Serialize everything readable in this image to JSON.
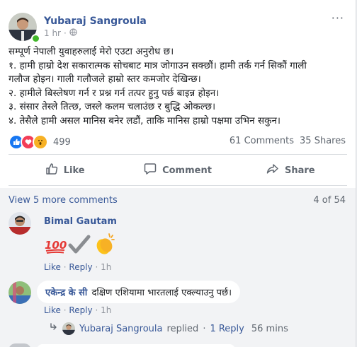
{
  "post": {
    "author": "Yubaraj Sangroula",
    "time": "1 hr",
    "time_sep": "·",
    "body_lines": [
      "सम्पूर्ण नेपाली युवाहरुलाई मेरो एउटा अनुरोध छ।",
      "१. हामी हाम्रो देश सकारात्मक सोचबाट मात्र जोगाउन सक्छौं। हामी तर्क गर्न सिकौं गाली",
      "गलौज होइन। गाली गलौजले हाम्रो स्तर कमजोर देखिन्छ।",
      "२. हामीले बिस्लेषण गर्न र प्रश्न गर्न तत्पर हुनु पर्छ बाइन्न होइन।",
      "३. संसार तेस्ले तित्छ, जस्ले कलम चलाउंछ र बुद्धि ओकल्छ।",
      "४. तेसैले हामी असल मानिस बनेर लडौं, ताकि मानिस हाम्रो पक्षमा उभिन सकुन।"
    ],
    "reaction_count": "499",
    "comments_count": "61 Comments",
    "shares_count": "35 Shares"
  },
  "actions": {
    "like": "Like",
    "comment": "Comment",
    "share": "Share"
  },
  "comments_header": {
    "view_more": "View 5 more comments",
    "page": "4 of 54"
  },
  "comments": [
    {
      "author": "Bimal Gautam",
      "emojis": [
        "100",
        "heavy-check",
        "clapping-hands"
      ],
      "emoji_text": "💯✔👏",
      "like": "Like",
      "reply": "Reply",
      "time": "1h",
      "sep": "·"
    },
    {
      "author": "एकेन्द्र के सी",
      "text": "दक्षिण एशियामा भारतलाई एक्ल्याउनु पर्छ।",
      "like": "Like",
      "reply": "Reply",
      "time": "1h",
      "sep": "·"
    }
  ],
  "reply_summary": {
    "author": "Yubaraj Sangroula",
    "label": "replied",
    "count": "1 Reply",
    "time": "56 mins",
    "sep": "·"
  },
  "colors": {
    "link": "#385898",
    "like_blue": "#1877f2",
    "love_red": "#f33e58",
    "wow_yellow": "#f7b125",
    "online_green": "#42b72a"
  }
}
